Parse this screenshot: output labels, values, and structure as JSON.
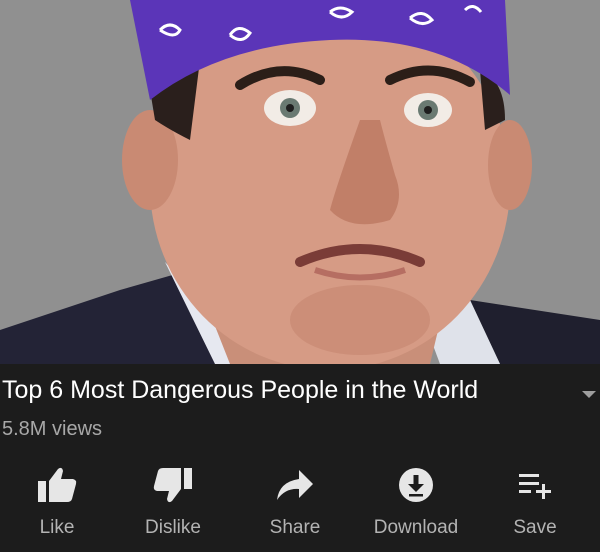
{
  "video": {
    "title": "Top 6 Most Dangerous People in the World",
    "views": "5.8M views"
  },
  "actions": [
    {
      "label": "Like",
      "icon": "thumbs-up-icon"
    },
    {
      "label": "Dislike",
      "icon": "thumbs-down-icon"
    },
    {
      "label": "Share",
      "icon": "share-arrow-icon"
    },
    {
      "label": "Download",
      "icon": "download-icon"
    },
    {
      "label": "Save",
      "icon": "add-to-playlist-icon"
    }
  ],
  "colors": {
    "background": "#1c1c1c",
    "title_text": "#ffffff",
    "secondary_text": "#a8a8a8",
    "icon": "#e6e6e6",
    "bandana": "#5b35b8"
  }
}
